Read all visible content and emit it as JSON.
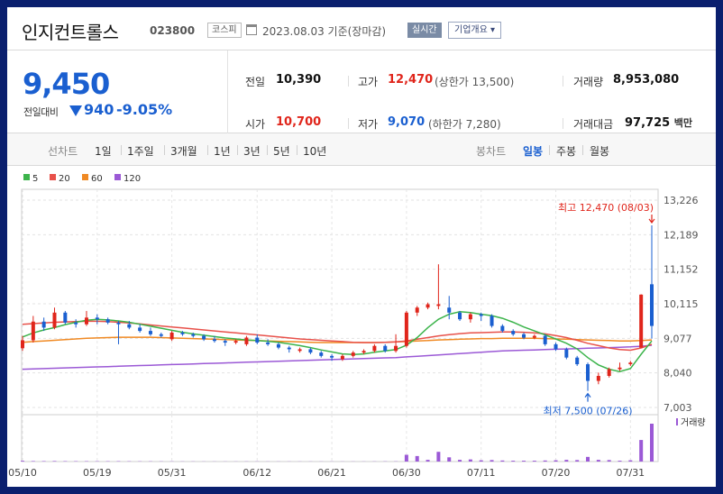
{
  "header": {
    "stock_name": "인지컨트롤스",
    "stock_code": "023800",
    "market": "코스피",
    "date": "2023.08.03",
    "basis": "기준(장마감)",
    "realtime_label": "실시간",
    "overview_label": "기업개요"
  },
  "summary": {
    "price": "9,450",
    "change_label": "전일대비",
    "change_value": "940",
    "change_rate": "-9.05%",
    "prev_close_label": "전일",
    "prev_close": "10,390",
    "open_label": "시가",
    "open": "10,700",
    "high_label": "고가",
    "high": "12,470",
    "upper_limit": "(상한가 13,500)",
    "low_label": "저가",
    "low": "9,070",
    "lower_limit": "(하한가 7,280)",
    "volume_label": "거래량",
    "volume": "8,953,080",
    "amount_label": "거래대금",
    "amount": "97,725",
    "amount_unit": "백만"
  },
  "toolbar": {
    "line_chart_label": "선차트",
    "periods": [
      "1일",
      "1주일",
      "3개월",
      "1년",
      "3년",
      "5년",
      "10년"
    ],
    "candle_label": "봉차트",
    "candle_periods": [
      "일봉",
      "주봉",
      "월봉"
    ],
    "active_candle": "일봉"
  },
  "colors": {
    "up": "#e0251b",
    "down": "#1a5fd0",
    "ma5": "#3cb44b",
    "ma20": "#e8514a",
    "ma60": "#f08a24",
    "ma120": "#9b59d6",
    "volume": "#9b59d6"
  },
  "chart_data": {
    "type": "candlestick",
    "legend": [
      {
        "name": "5",
        "color": "#3cb44b"
      },
      {
        "name": "20",
        "color": "#e8514a"
      },
      {
        "name": "60",
        "color": "#f08a24"
      },
      {
        "name": "120",
        "color": "#9b59d6"
      }
    ],
    "y_ticks": [
      13226,
      12189,
      11152,
      10115,
      9077,
      8040,
      7003
    ],
    "y_tick_labels": [
      "13,226",
      "12,189",
      "11,152",
      "10,115",
      "9,077",
      "8,040",
      "7,003"
    ],
    "ylim": [
      7003,
      13226
    ],
    "x_tick_labels": [
      "05/10",
      "05/19",
      "05/31",
      "06/12",
      "06/21",
      "06/30",
      "07/11",
      "07/20",
      "07/31"
    ],
    "x_tick_index": [
      0,
      7,
      14,
      22,
      29,
      36,
      43,
      50,
      57
    ],
    "volume_legend": "거래량",
    "high_annotation": "최고 12,470 (08/03)",
    "low_annotation": "최저 7,500 (07/26)",
    "candles": [
      {
        "o": 8780,
        "h": 9150,
        "l": 8700,
        "c": 9020
      },
      {
        "o": 9020,
        "h": 9750,
        "l": 8950,
        "c": 9580
      },
      {
        "o": 9580,
        "h": 9700,
        "l": 9300,
        "c": 9400
      },
      {
        "o": 9400,
        "h": 10000,
        "l": 9350,
        "c": 9850
      },
      {
        "o": 9850,
        "h": 9900,
        "l": 9500,
        "c": 9550
      },
      {
        "o": 9550,
        "h": 9650,
        "l": 9400,
        "c": 9500
      },
      {
        "o": 9500,
        "h": 9900,
        "l": 9450,
        "c": 9700
      },
      {
        "o": 9700,
        "h": 9800,
        "l": 9500,
        "c": 9650
      },
      {
        "o": 9650,
        "h": 9700,
        "l": 9500,
        "c": 9550
      },
      {
        "o": 9550,
        "h": 9600,
        "l": 8900,
        "c": 9500
      },
      {
        "o": 9500,
        "h": 9600,
        "l": 9350,
        "c": 9400
      },
      {
        "o": 9400,
        "h": 9500,
        "l": 9250,
        "c": 9300
      },
      {
        "o": 9300,
        "h": 9400,
        "l": 9150,
        "c": 9200
      },
      {
        "o": 9200,
        "h": 9250,
        "l": 9100,
        "c": 9150
      },
      {
        "o": 9050,
        "h": 9300,
        "l": 9000,
        "c": 9250
      },
      {
        "o": 9250,
        "h": 9300,
        "l": 9150,
        "c": 9200
      },
      {
        "o": 9200,
        "h": 9250,
        "l": 9100,
        "c": 9150
      },
      {
        "o": 9150,
        "h": 9200,
        "l": 9000,
        "c": 9050
      },
      {
        "o": 9050,
        "h": 9150,
        "l": 8950,
        "c": 9000
      },
      {
        "o": 9000,
        "h": 9050,
        "l": 8850,
        "c": 8950
      },
      {
        "o": 8950,
        "h": 9050,
        "l": 8900,
        "c": 9000
      },
      {
        "o": 8900,
        "h": 9150,
        "l": 8850,
        "c": 9100
      },
      {
        "o": 9100,
        "h": 9200,
        "l": 8900,
        "c": 8950
      },
      {
        "o": 8950,
        "h": 9050,
        "l": 8850,
        "c": 8900
      },
      {
        "o": 8900,
        "h": 8950,
        "l": 8750,
        "c": 8800
      },
      {
        "o": 8800,
        "h": 8850,
        "l": 8650,
        "c": 8750
      },
      {
        "o": 8700,
        "h": 8800,
        "l": 8650,
        "c": 8750
      },
      {
        "o": 8750,
        "h": 8800,
        "l": 8600,
        "c": 8650
      },
      {
        "o": 8650,
        "h": 8700,
        "l": 8500,
        "c": 8550
      },
      {
        "o": 8550,
        "h": 8600,
        "l": 8400,
        "c": 8500
      },
      {
        "o": 8450,
        "h": 8600,
        "l": 8400,
        "c": 8550
      },
      {
        "o": 8550,
        "h": 8700,
        "l": 8500,
        "c": 8650
      },
      {
        "o": 8650,
        "h": 8750,
        "l": 8600,
        "c": 8700
      },
      {
        "o": 8700,
        "h": 8900,
        "l": 8650,
        "c": 8850
      },
      {
        "o": 8850,
        "h": 8900,
        "l": 8650,
        "c": 8700
      },
      {
        "o": 8700,
        "h": 9200,
        "l": 8650,
        "c": 8850
      },
      {
        "o": 8850,
        "h": 9900,
        "l": 8800,
        "c": 9850
      },
      {
        "o": 9850,
        "h": 10050,
        "l": 9750,
        "c": 10000
      },
      {
        "o": 10000,
        "h": 10150,
        "l": 9950,
        "c": 10100
      },
      {
        "o": 10050,
        "h": 11300,
        "l": 9950,
        "c": 10100
      },
      {
        "o": 10000,
        "h": 10350,
        "l": 9650,
        "c": 9850
      },
      {
        "o": 9850,
        "h": 9900,
        "l": 9600,
        "c": 9650
      },
      {
        "o": 9650,
        "h": 9850,
        "l": 9550,
        "c": 9800
      },
      {
        "o": 9800,
        "h": 9850,
        "l": 9600,
        "c": 9750
      },
      {
        "o": 9750,
        "h": 9800,
        "l": 9400,
        "c": 9450
      },
      {
        "o": 9450,
        "h": 9500,
        "l": 9250,
        "c": 9300
      },
      {
        "o": 9300,
        "h": 9350,
        "l": 9150,
        "c": 9200
      },
      {
        "o": 9200,
        "h": 9250,
        "l": 9050,
        "c": 9100
      },
      {
        "o": 9100,
        "h": 9200,
        "l": 9050,
        "c": 9150
      },
      {
        "o": 9150,
        "h": 9200,
        "l": 8850,
        "c": 8900
      },
      {
        "o": 8900,
        "h": 8950,
        "l": 8700,
        "c": 8750
      },
      {
        "o": 8750,
        "h": 8800,
        "l": 8450,
        "c": 8500
      },
      {
        "o": 8500,
        "h": 8550,
        "l": 8250,
        "c": 8300
      },
      {
        "o": 8300,
        "h": 8350,
        "l": 7500,
        "c": 7800
      },
      {
        "o": 7800,
        "h": 8050,
        "l": 7700,
        "c": 7950
      },
      {
        "o": 7950,
        "h": 8200,
        "l": 7900,
        "c": 8150
      },
      {
        "o": 8150,
        "h": 8350,
        "l": 8100,
        "c": 8200
      },
      {
        "o": 8300,
        "h": 8400,
        "l": 8250,
        "c": 8350
      },
      {
        "o": 8800,
        "h": 10400,
        "l": 8800,
        "c": 10390
      },
      {
        "o": 10700,
        "h": 12470,
        "l": 9070,
        "c": 9450
      }
    ],
    "volumes": [
      180000,
      120000,
      110000,
      130000,
      100000,
      90000,
      90000,
      80000,
      80000,
      90000,
      70000,
      60000,
      60000,
      50000,
      50000,
      40000,
      40000,
      30000,
      30000,
      30000,
      30000,
      40000,
      40000,
      30000,
      30000,
      30000,
      30000,
      30000,
      30000,
      30000,
      30000,
      30000,
      30000,
      40000,
      50000,
      50000,
      1600000,
      1300000,
      400000,
      2300000,
      1000000,
      400000,
      500000,
      300000,
      350000,
      250000,
      200000,
      200000,
      200000,
      250000,
      300000,
      400000,
      350000,
      1100000,
      400000,
      350000,
      200000,
      300000,
      5100000,
      8953080
    ],
    "ma5": [
      9120,
      9240,
      9330,
      9400,
      9490,
      9560,
      9620,
      9650,
      9630,
      9600,
      9560,
      9500,
      9440,
      9380,
      9320,
      9260,
      9210,
      9170,
      9130,
      9090,
      9060,
      9030,
      9010,
      8990,
      8960,
      8910,
      8860,
      8800,
      8730,
      8670,
      8610,
      8590,
      8610,
      8660,
      8700,
      8740,
      8870,
      9100,
      9400,
      9650,
      9800,
      9880,
      9850,
      9800,
      9760,
      9680,
      9560,
      9420,
      9300,
      9180,
      9060,
      8930,
      8760,
      8500,
      8280,
      8150,
      8080,
      8170,
      8600,
      9000
    ],
    "ma20": [
      9500,
      9520,
      9540,
      9560,
      9570,
      9580,
      9590,
      9590,
      9580,
      9560,
      9540,
      9510,
      9480,
      9450,
      9420,
      9390,
      9360,
      9330,
      9300,
      9270,
      9240,
      9210,
      9180,
      9150,
      9120,
      9090,
      9060,
      9040,
      9020,
      9000,
      8980,
      8960,
      8950,
      8950,
      8960,
      8970,
      9000,
      9050,
      9100,
      9150,
      9190,
      9220,
      9240,
      9250,
      9260,
      9270,
      9270,
      9260,
      9240,
      9210,
      9160,
      9100,
      9020,
      8930,
      8860,
      8790,
      8740,
      8720,
      8790,
      8900
    ],
    "ma60": [
      8960,
      8980,
      9000,
      9020,
      9040,
      9060,
      9080,
      9090,
      9100,
      9110,
      9110,
      9110,
      9110,
      9100,
      9090,
      9080,
      9070,
      9060,
      9050,
      9040,
      9030,
      9020,
      9010,
      9000,
      8990,
      8980,
      8970,
      8960,
      8950,
      8950,
      8950,
      8950,
      8950,
      8950,
      8960,
      8970,
      8980,
      9000,
      9010,
      9030,
      9040,
      9050,
      9060,
      9070,
      9070,
      9080,
      9080,
      9080,
      9080,
      9070,
      9060,
      9050,
      9040,
      9030,
      9020,
      9010,
      9000,
      9000,
      9010,
      9030
    ],
    "ma120": [
      8150,
      8160,
      8170,
      8180,
      8190,
      8200,
      8210,
      8220,
      8230,
      8240,
      8250,
      8260,
      8270,
      8280,
      8290,
      8300,
      8310,
      8320,
      8330,
      8340,
      8350,
      8360,
      8370,
      8380,
      8390,
      8400,
      8410,
      8420,
      8430,
      8440,
      8450,
      8460,
      8470,
      8480,
      8490,
      8500,
      8520,
      8540,
      8560,
      8580,
      8600,
      8620,
      8640,
      8660,
      8680,
      8700,
      8710,
      8720,
      8730,
      8740,
      8750,
      8760,
      8770,
      8780,
      8790,
      8800,
      8810,
      8820,
      8840,
      8870
    ]
  }
}
